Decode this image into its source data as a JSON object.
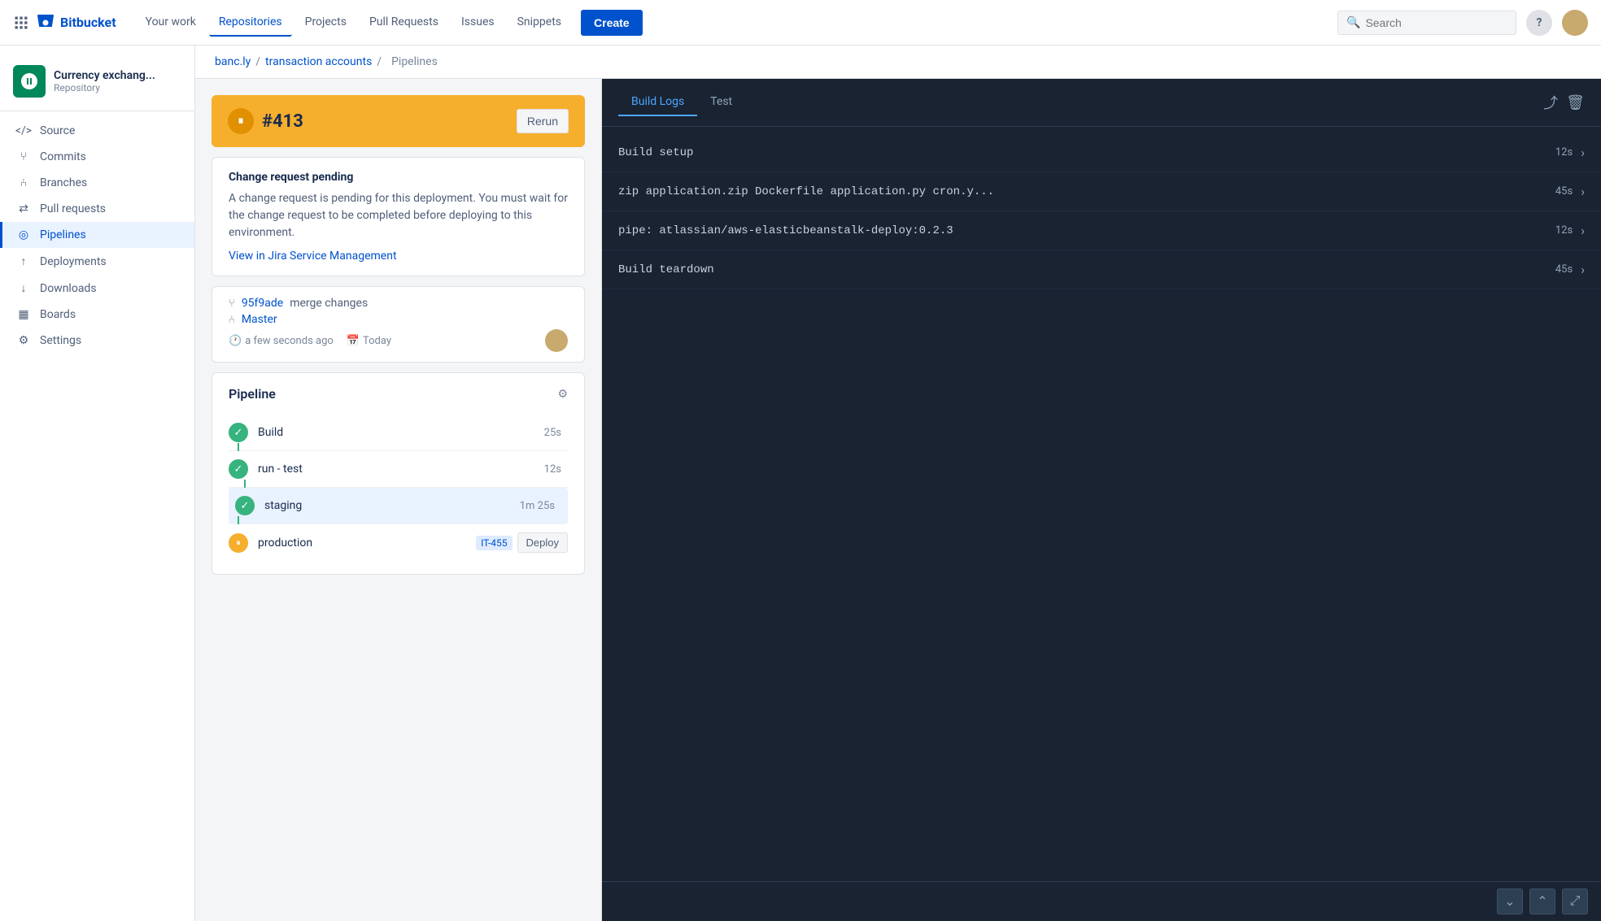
{
  "topnav": {
    "logo_text": "Bitbucket",
    "links": [
      {
        "label": "Your work",
        "active": false
      },
      {
        "label": "Repositories",
        "active": true
      },
      {
        "label": "Projects",
        "active": false
      },
      {
        "label": "Pull Requests",
        "active": false
      },
      {
        "label": "Issues",
        "active": false
      },
      {
        "label": "Snippets",
        "active": false
      }
    ],
    "create_label": "Create",
    "search_placeholder": "Search",
    "help_label": "?"
  },
  "sidebar": {
    "repo_name": "Currency exchang...",
    "repo_type": "Repository",
    "nav_items": [
      {
        "label": "Source",
        "active": false,
        "icon": "source"
      },
      {
        "label": "Commits",
        "active": false,
        "icon": "commits"
      },
      {
        "label": "Branches",
        "active": false,
        "icon": "branches"
      },
      {
        "label": "Pull requests",
        "active": false,
        "icon": "pullrequests"
      },
      {
        "label": "Pipelines",
        "active": true,
        "icon": "pipelines"
      },
      {
        "label": "Deployments",
        "active": false,
        "icon": "deployments"
      },
      {
        "label": "Downloads",
        "active": false,
        "icon": "downloads"
      },
      {
        "label": "Boards",
        "active": false,
        "icon": "boards"
      },
      {
        "label": "Settings",
        "active": false,
        "icon": "settings"
      }
    ]
  },
  "breadcrumb": {
    "parts": [
      "banc.ly",
      "transaction accounts",
      "Pipelines"
    ]
  },
  "pipeline": {
    "number": "#413",
    "rerun_label": "Rerun",
    "status": "paused",
    "change_request": {
      "title": "Change request pending",
      "description": "A change request is pending for this deployment. You must wait for the change request to be completed before deploying to this environment.",
      "jira_link_label": "View in Jira Service Management"
    },
    "commit_hash": "95f9ade",
    "commit_message": "merge changes",
    "branch": "Master",
    "time_ago": "a few seconds ago",
    "date": "Today",
    "steps_title": "Pipeline",
    "steps": [
      {
        "name": "Build",
        "duration": "25s",
        "status": "success",
        "has_connector": false
      },
      {
        "name": "run - test",
        "duration": "12s",
        "status": "success",
        "has_connector": true
      },
      {
        "name": "staging",
        "duration": "1m 25s",
        "status": "success",
        "active": true,
        "has_connector": true
      },
      {
        "name": "production",
        "duration": "",
        "status": "pending",
        "badge": "IT-455",
        "deploy_label": "Deploy",
        "has_connector": true
      }
    ]
  },
  "build_logs": {
    "tabs": [
      {
        "label": "Build Logs",
        "active": true
      },
      {
        "label": "Test",
        "active": false
      }
    ],
    "log_items": [
      {
        "name": "Build setup",
        "duration": "12s"
      },
      {
        "name": "zip application.zip Dockerfile application.py cron.y...",
        "duration": "45s"
      },
      {
        "name": "pipe: atlassian/aws-elasticbeanstalk-deploy:0.2.3",
        "duration": "12s"
      },
      {
        "name": "Build teardown",
        "duration": "45s"
      }
    ],
    "footer_buttons": [
      "chevron-down",
      "chevron-up",
      "expand"
    ]
  }
}
